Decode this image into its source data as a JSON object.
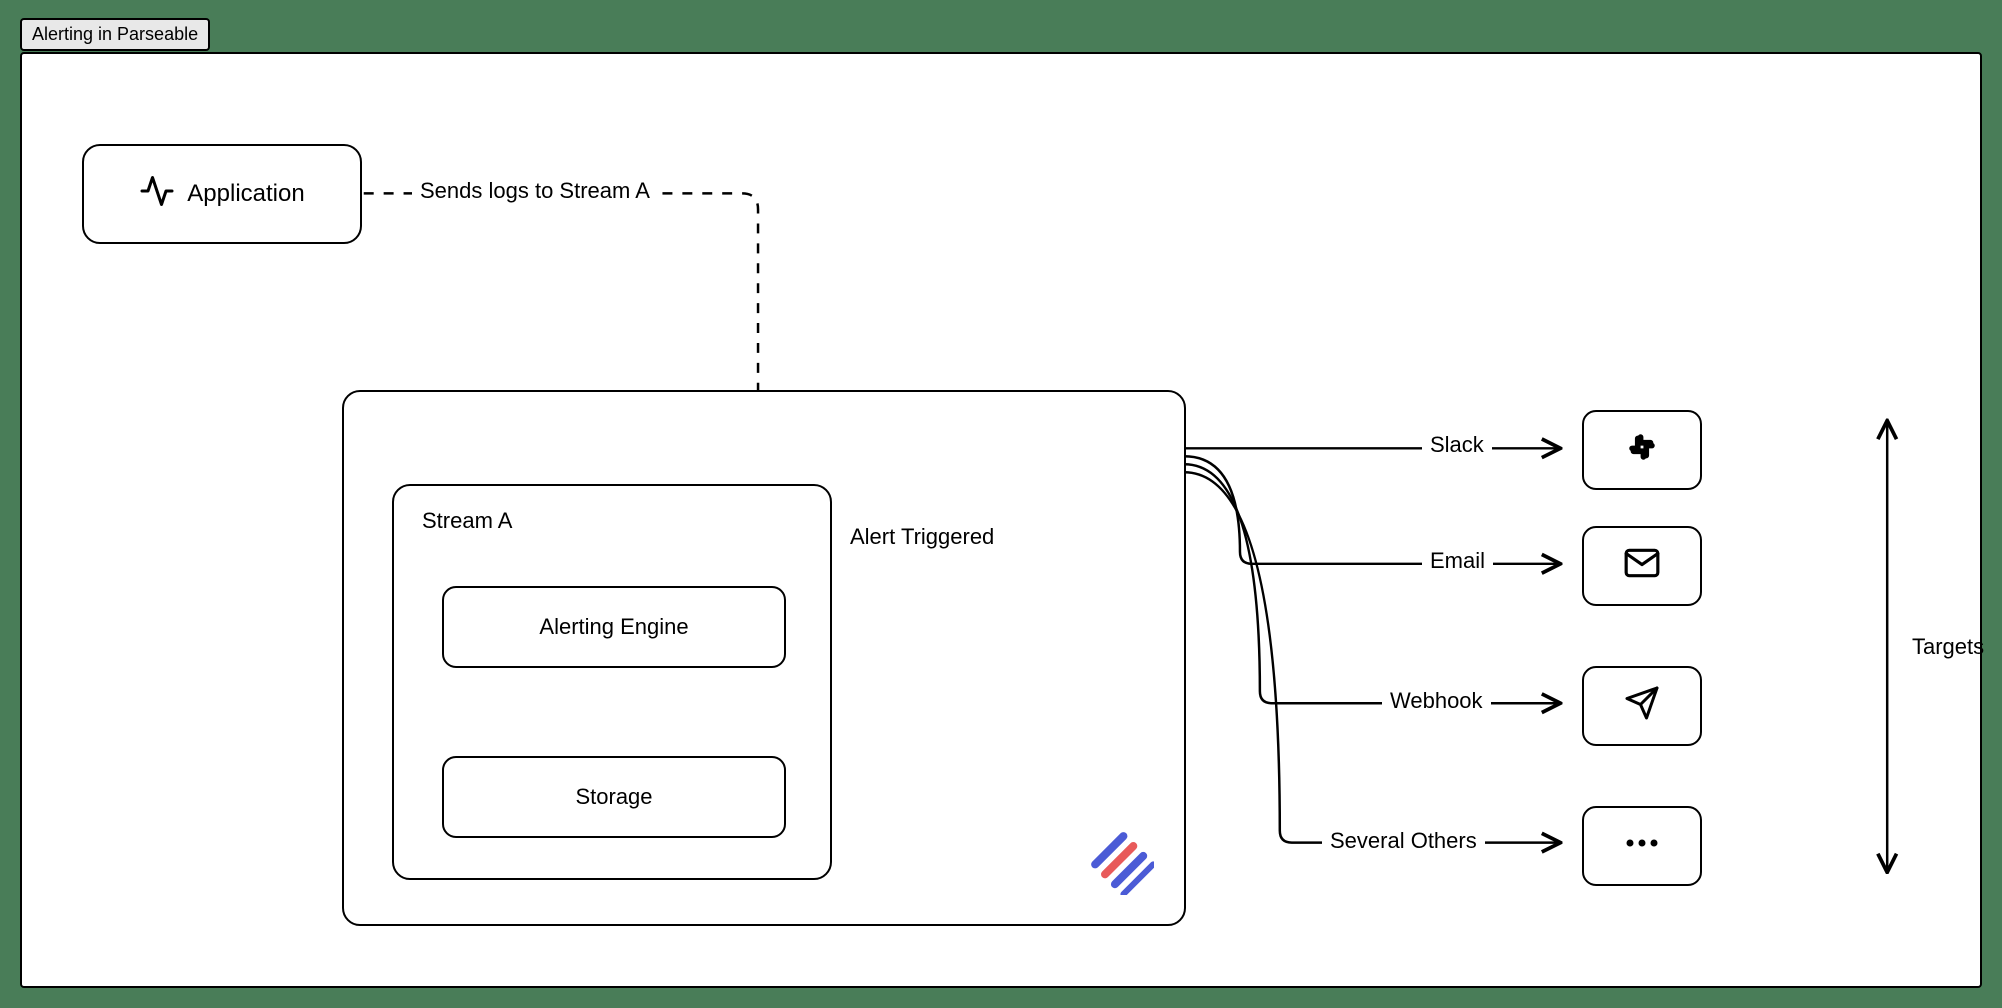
{
  "tab_title": "Alerting in Parseable",
  "nodes": {
    "application": "Application",
    "stream_a": "Stream A",
    "alerting_engine": "Alerting Engine",
    "storage": "Storage"
  },
  "edges": {
    "sends_logs": "Sends logs to Stream A",
    "alert_triggered": "Alert Triggered"
  },
  "targets_label": "Targets",
  "targets": {
    "slack": "Slack",
    "email": "Email",
    "webhook": "Webhook",
    "others": "Several Others"
  }
}
